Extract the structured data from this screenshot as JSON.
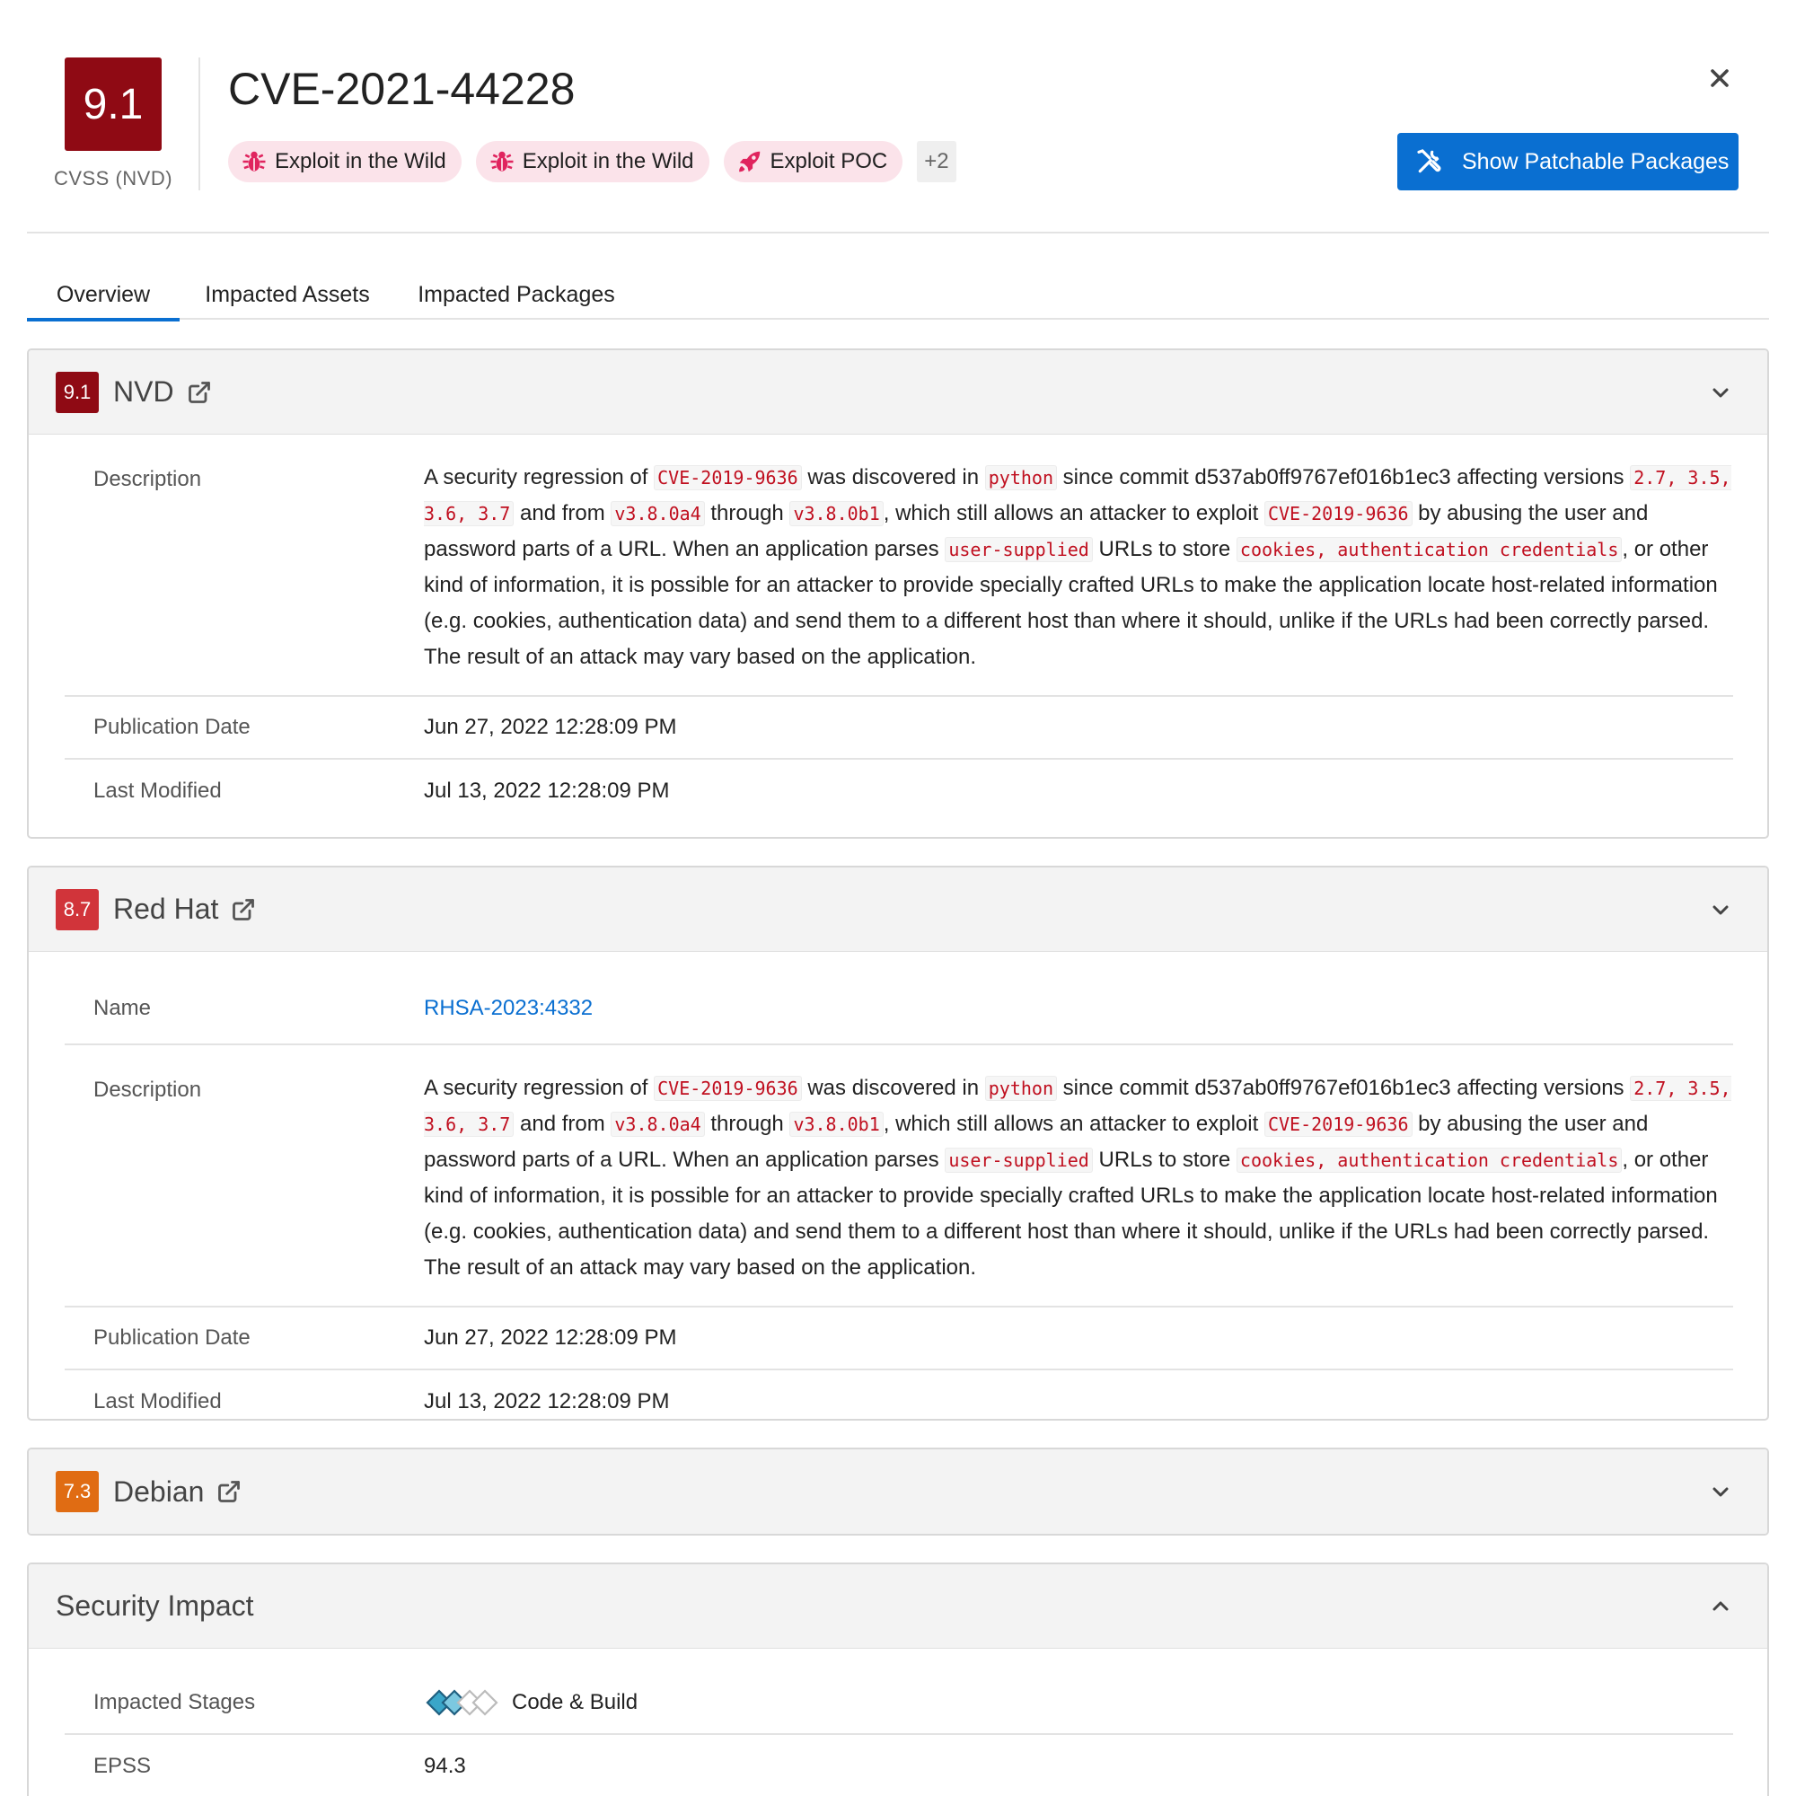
{
  "header": {
    "score": "9.1",
    "score_caption": "CVSS (NVD)",
    "cve_id": "CVE-2021-44228",
    "tags": [
      {
        "label": "Exploit in the Wild",
        "icon": "bug-icon"
      },
      {
        "label": "Exploit in the Wild",
        "icon": "bug-icon"
      },
      {
        "label": "Exploit POC",
        "icon": "rocket-icon"
      }
    ],
    "more_tags": "+2",
    "primary_button": "Show Patchable Packages",
    "tag_icon_color": "#e0245e",
    "primary_color": "#0a6fd1"
  },
  "tabs": [
    "Overview",
    "Impacted Assets",
    "Impacted Packages"
  ],
  "labels": {
    "description": "Description",
    "publication_date": "Publication Date",
    "last_modified": "Last Modified",
    "name": "Name",
    "impacted_stages": "Impacted Stages",
    "epss": "EPSS"
  },
  "description": {
    "p1": "A security regression of ",
    "c1": "CVE-2019-9636",
    "p2": " was discovered in ",
    "c2": "python",
    "p3": " since commit d537ab0ff9767ef016b1ec3 affecting versions ",
    "c3": "2.7, 3.5, 3.6, 3.7",
    "p4": " and from ",
    "c4": "v3.8.0a4",
    "p5": " through ",
    "c5": "v3.8.0b1",
    "p6": ", which still allows an attacker to exploit ",
    "c6": "CVE-2019-9636",
    "p7": " by abusing the user and password parts of a URL. When an application parses ",
    "c7": "user-supplied",
    "p8": " URLs to store ",
    "c8": "cookies, authentication credentials",
    "p9": ", or other kind of information, it is possible for an attacker to provide specially crafted URLs to make the application locate host-related information (e.g. cookies, authentication data) and send them to a different host than where it should, unlike if the URLs had been correctly parsed. The result of an attack may vary based on the application."
  },
  "sources": {
    "nvd": {
      "score": "9.1",
      "name": "NVD",
      "color": "#8f0a14",
      "publication_date": "Jun 27, 2022 12:28:09 PM",
      "last_modified": "Jul 13, 2022 12:28:09 PM"
    },
    "redhat": {
      "score": "8.7",
      "name": "Red Hat",
      "color": "#d1343a",
      "advisory": "RHSA-2023:4332",
      "publication_date": "Jun 27, 2022 12:28:09 PM",
      "last_modified": "Jul 13, 2022 12:28:09 PM"
    },
    "debian": {
      "score": "7.3",
      "name": "Debian",
      "color": "#e06c13"
    }
  },
  "security_impact": {
    "title": "Security Impact",
    "stage": "Code & Build",
    "epss": "94.3"
  }
}
